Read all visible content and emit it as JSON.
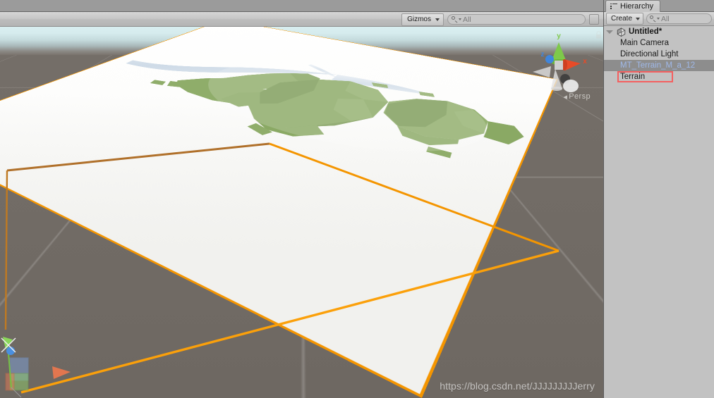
{
  "scene_view": {
    "toolbar": {
      "gizmos_label": "Gizmos",
      "gizmos_caret_icon": "chevron-down-icon",
      "search_icon": "search-icon",
      "search_value": "",
      "search_placeholder": "All",
      "search_dropdown_icon": "chevron-down-icon"
    },
    "view_gizmo": {
      "axis_x": "x",
      "axis_y": "y",
      "axis_z": "z",
      "projection_label": "Persp",
      "projection_arrow_icon": "arrow-left-icon",
      "lock_icon": "lock-icon"
    },
    "watermark": "https://blog.csdn.net/JJJJJJJJJerry",
    "colors": {
      "selection_outline": "#f49500",
      "selection_outline_far": "#b06a1c",
      "sky_top": "#d9eef0",
      "ground": "#726c66",
      "terrain_surface": "#f6f5f3",
      "terrain_forest": "#8aa964",
      "terrain_forest_shadow": "#7d9b58",
      "river": "#d8e2ec",
      "gizmo_x": "#e2502a",
      "gizmo_y": "#76c043",
      "gizmo_z": "#3a7fd5"
    }
  },
  "hierarchy": {
    "tab": {
      "label": "Hierarchy",
      "icon": "hierarchy-list-icon"
    },
    "toolbar": {
      "create_label": "Create",
      "create_caret_icon": "chevron-down-icon",
      "search_icon": "search-icon",
      "search_value": "",
      "search_placeholder": "All",
      "search_dropdown_icon": "chevron-down-icon"
    },
    "scene": {
      "name": "Untitled*",
      "expanded": true,
      "disclosure_icon": "triangle-down-icon",
      "icon": "unity-scene-icon"
    },
    "items": [
      {
        "label": "Main Camera",
        "selected": false,
        "outlined": false
      },
      {
        "label": "Directional Light",
        "selected": false,
        "outlined": false
      },
      {
        "label": "MT_Terrain_M_a_12",
        "selected": true,
        "outlined": false
      },
      {
        "label": "Terrain",
        "selected": false,
        "outlined": true
      }
    ]
  }
}
